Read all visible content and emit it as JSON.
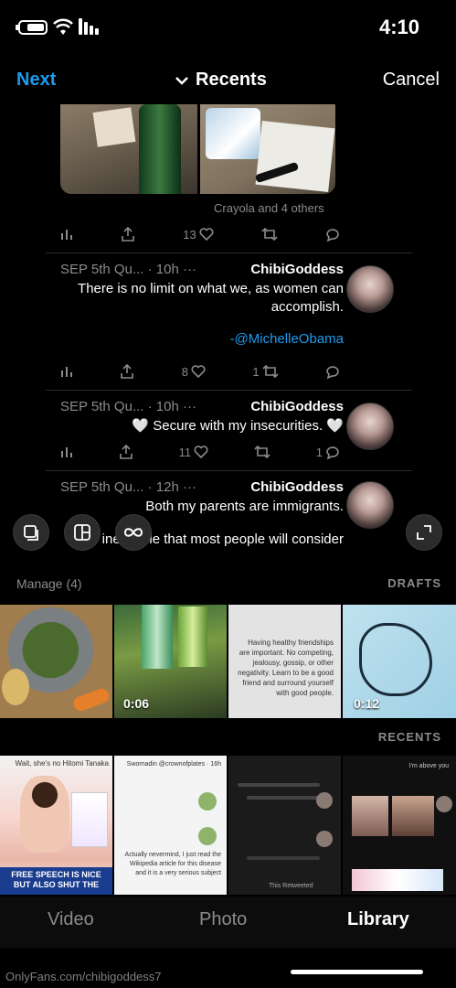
{
  "status_bar": {
    "time": "4:10"
  },
  "header": {
    "next_label": "Next",
    "title": "Recents",
    "cancel_label": "Cancel"
  },
  "preview": {
    "caption": "Crayola and 4 others",
    "first_actions": {
      "likes": "13"
    },
    "tweets": [
      {
        "name": "ChibiGoddess",
        "meta": "SEP 5th Qu... · 10h ···",
        "body": "There is no limit on what we, as women can accomplish.",
        "mention": "-@MichelleObama",
        "likes": "8",
        "retweets": "1"
      },
      {
        "name": "ChibiGoddess",
        "meta": "SEP 5th Qu... · 10h ···",
        "body": "🤍 Secure with my insecurities. 🤍",
        "likes": "11",
        "retweets": "",
        "replies": "1"
      },
      {
        "name": "ChibiGoddess",
        "meta": "SEP 5th Qu... · 12h ···",
        "body": "Both my parents are immigrants.",
        "body2": "It's inevitable that most people will consider me \"weird\" after meeting me"
      }
    ]
  },
  "drafts": {
    "manage_label": "Manage (4)",
    "section_label": "DRAFTS",
    "items": [
      {
        "kind": "photo",
        "duration": ""
      },
      {
        "kind": "video",
        "duration": "0:06"
      },
      {
        "kind": "text",
        "text": "Having healthy friendships are important. No competing, jealousy, gossip, or other negativity. Learn to be a good friend and surround yourself with good people.",
        "duration": ""
      },
      {
        "kind": "video",
        "duration": "0:12"
      }
    ]
  },
  "recents": {
    "section_label": "RECENTS",
    "r1_banner": "FREE SPEECH IS NICE BUT ALSO SHUT THE",
    "r1_top": "Wait, she's no Hitomi Tanaka",
    "r2_top": "Swornadin @crownofplates · 16h",
    "r2_body": "Actually nevermind, I just read the Wikipedia article for this disease and it is a very serious subject",
    "r3_bottom": "This Retweeted",
    "r4_top": "I'm above you"
  },
  "tabs": {
    "video": "Video",
    "photo": "Photo",
    "library": "Library"
  },
  "watermark": "OnlyFans.com/chibigoddess7",
  "colors": {
    "accent": "#1d9bf0",
    "background": "#000000",
    "muted": "#8b8b8b"
  }
}
